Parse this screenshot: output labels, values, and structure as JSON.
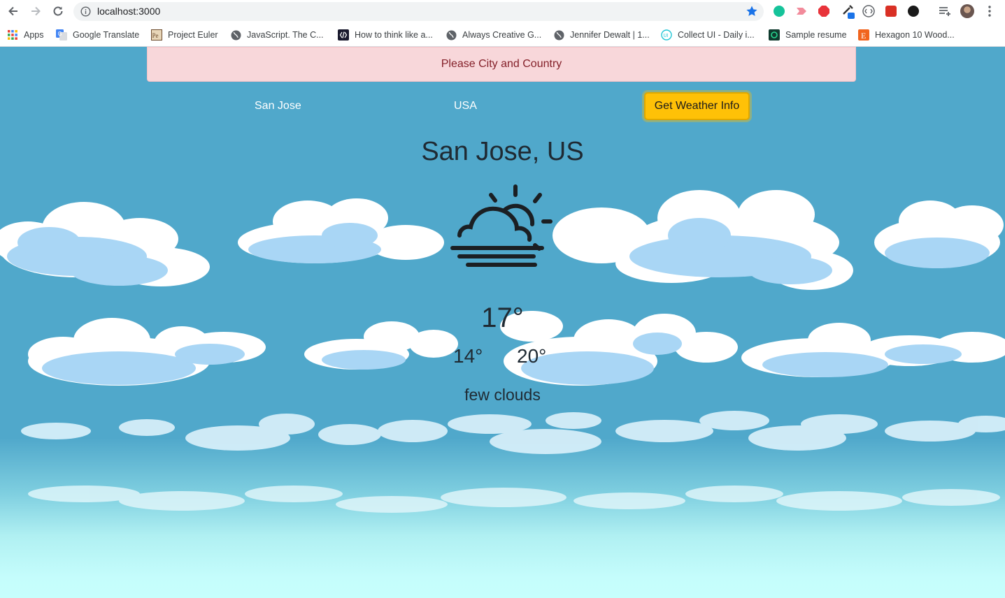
{
  "browser": {
    "url": "localhost:3000",
    "bookmarks": [
      {
        "label": "Apps",
        "icon": "apps-grid-icon"
      },
      {
        "label": "Google Translate",
        "icon": "google-translate-icon"
      },
      {
        "label": "Project Euler",
        "icon": "project-euler-icon"
      },
      {
        "label": "JavaScript. The C...",
        "icon": "globe-icon"
      },
      {
        "label": "How to think like a...",
        "icon": "code-logo-icon"
      },
      {
        "label": "Always Creative G...",
        "icon": "globe-icon"
      },
      {
        "label": "Jennifer Dewalt | 1...",
        "icon": "globe-icon"
      },
      {
        "label": "Collect UI - Daily i...",
        "icon": "collect-ui-icon"
      },
      {
        "label": "Sample resume",
        "icon": "sample-resume-icon"
      },
      {
        "label": "Hexagon 10 Wood...",
        "icon": "etsy-icon"
      }
    ],
    "extensions": [
      "grammarly-icon",
      "extension-pink-icon",
      "adblock-icon",
      "eyedropper-icon",
      "extension-circle-icon",
      "extension-red-icon",
      "onepassword-icon",
      "reading-list-icon",
      "profile-avatar-icon",
      "menu-kebab-icon"
    ],
    "colors": {
      "star": "#1a73e8",
      "omnibox": "#f1f3f4"
    }
  },
  "app": {
    "alert": "Please City and Country",
    "city_value": "San Jose",
    "country_value": "USA",
    "button_label": "Get Weather Info",
    "location": "San Jose, US",
    "weather_icon": "sunrise-haze-icon",
    "temperature": "17°",
    "min_temp": "14°",
    "max_temp": "20°",
    "description": "few clouds",
    "colors": {
      "sky": "#50a8cb",
      "horizon": "#c6fffd",
      "alert_bg": "#f8d7da",
      "alert_text": "#842029",
      "button": "#ffc107"
    }
  }
}
